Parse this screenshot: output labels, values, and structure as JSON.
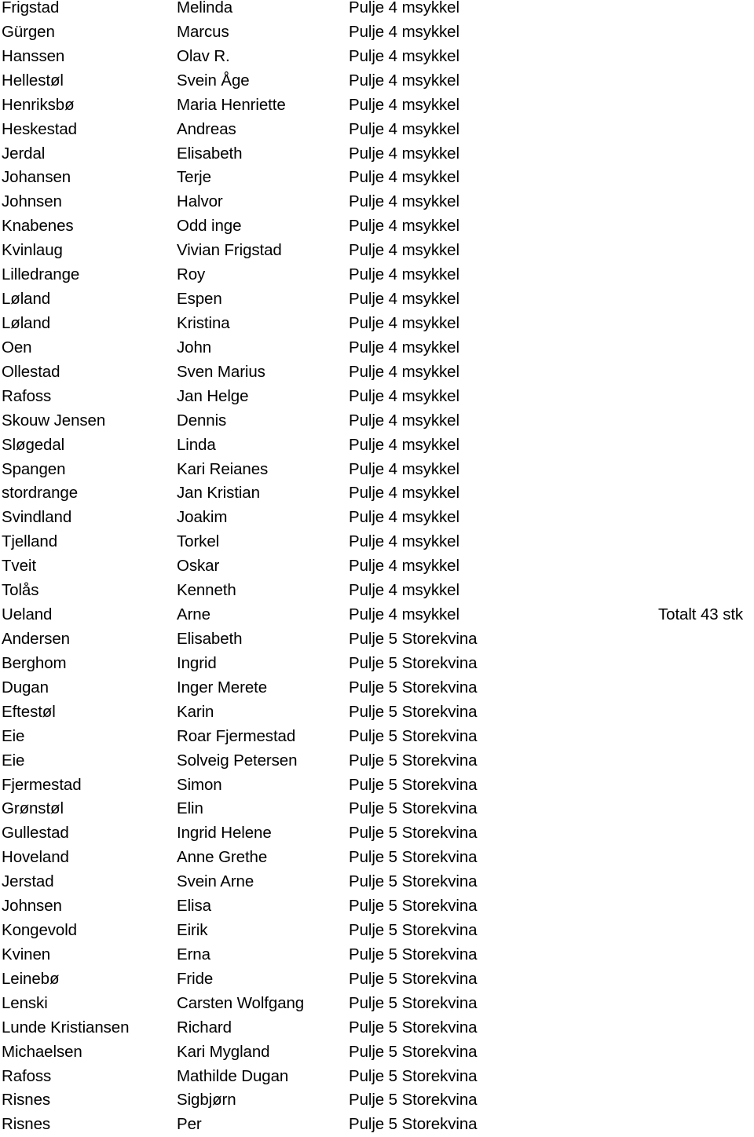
{
  "document": {
    "rows": [
      {
        "last_name": "Frigstad",
        "first_name": "Melinda",
        "pool": "Pulje 4 msykkel",
        "note": ""
      },
      {
        "last_name": "Gürgen",
        "first_name": "Marcus",
        "pool": "Pulje 4 msykkel",
        "note": ""
      },
      {
        "last_name": "Hanssen",
        "first_name": "Olav R.",
        "pool": "Pulje 4 msykkel",
        "note": ""
      },
      {
        "last_name": "Hellestøl",
        "first_name": "Svein Åge",
        "pool": "Pulje 4 msykkel",
        "note": ""
      },
      {
        "last_name": "Henriksbø",
        "first_name": "Maria Henriette",
        "pool": "Pulje 4 msykkel",
        "note": ""
      },
      {
        "last_name": "Heskestad",
        "first_name": "Andreas",
        "pool": "Pulje 4 msykkel",
        "note": ""
      },
      {
        "last_name": "Jerdal",
        "first_name": "Elisabeth",
        "pool": "Pulje 4 msykkel",
        "note": ""
      },
      {
        "last_name": "Johansen",
        "first_name": "Terje",
        "pool": "Pulje 4 msykkel",
        "note": ""
      },
      {
        "last_name": "Johnsen",
        "first_name": "Halvor",
        "pool": "Pulje 4 msykkel",
        "note": ""
      },
      {
        "last_name": "Knabenes",
        "first_name": "Odd inge",
        "pool": "Pulje 4 msykkel",
        "note": ""
      },
      {
        "last_name": "Kvinlaug",
        "first_name": "Vivian Frigstad",
        "pool": "Pulje 4 msykkel",
        "note": ""
      },
      {
        "last_name": "Lilledrange",
        "first_name": "Roy",
        "pool": "Pulje 4 msykkel",
        "note": ""
      },
      {
        "last_name": "Løland",
        "first_name": "Espen",
        "pool": "Pulje 4 msykkel",
        "note": ""
      },
      {
        "last_name": "Løland",
        "first_name": "Kristina",
        "pool": "Pulje 4 msykkel",
        "note": ""
      },
      {
        "last_name": "Oen",
        "first_name": "John",
        "pool": "Pulje 4 msykkel",
        "note": ""
      },
      {
        "last_name": "Ollestad",
        "first_name": "Sven Marius",
        "pool": "Pulje 4 msykkel",
        "note": ""
      },
      {
        "last_name": "Rafoss",
        "first_name": "Jan Helge",
        "pool": "Pulje 4 msykkel",
        "note": ""
      },
      {
        "last_name": "Skouw Jensen",
        "first_name": "Dennis",
        "pool": "Pulje 4 msykkel",
        "note": ""
      },
      {
        "last_name": "Sløgedal",
        "first_name": "Linda",
        "pool": "Pulje 4 msykkel",
        "note": ""
      },
      {
        "last_name": "Spangen",
        "first_name": "Kari Reianes",
        "pool": "Pulje 4 msykkel",
        "note": ""
      },
      {
        "last_name": "stordrange",
        "first_name": "Jan Kristian",
        "pool": "Pulje 4 msykkel",
        "note": ""
      },
      {
        "last_name": "Svindland",
        "first_name": "Joakim",
        "pool": "Pulje 4 msykkel",
        "note": ""
      },
      {
        "last_name": "Tjelland",
        "first_name": "Torkel",
        "pool": "Pulje 4 msykkel",
        "note": ""
      },
      {
        "last_name": "Tveit",
        "first_name": "Oskar",
        "pool": "Pulje 4 msykkel",
        "note": ""
      },
      {
        "last_name": "Tolås",
        "first_name": "Kenneth",
        "pool": "Pulje 4 msykkel",
        "note": ""
      },
      {
        "last_name": "Ueland",
        "first_name": "Arne",
        "pool": "Pulje 4 msykkel",
        "note": "Totalt 43 stk"
      },
      {
        "last_name": "Andersen",
        "first_name": "Elisabeth",
        "pool": "Pulje 5 Storekvina",
        "note": ""
      },
      {
        "last_name": "Berghom",
        "first_name": "Ingrid",
        "pool": "Pulje 5 Storekvina",
        "note": ""
      },
      {
        "last_name": "Dugan",
        "first_name": "Inger Merete",
        "pool": "Pulje 5 Storekvina",
        "note": ""
      },
      {
        "last_name": "Eftestøl",
        "first_name": "Karin",
        "pool": "Pulje 5 Storekvina",
        "note": ""
      },
      {
        "last_name": "Eie",
        "first_name": "Roar Fjermestad",
        "pool": "Pulje 5 Storekvina",
        "note": ""
      },
      {
        "last_name": "Eie",
        "first_name": "Solveig Petersen",
        "pool": "Pulje 5 Storekvina",
        "note": ""
      },
      {
        "last_name": "Fjermestad",
        "first_name": "Simon",
        "pool": "Pulje 5 Storekvina",
        "note": ""
      },
      {
        "last_name": "Grønstøl",
        "first_name": "Elin",
        "pool": "Pulje 5 Storekvina",
        "note": ""
      },
      {
        "last_name": "Gullestad",
        "first_name": "Ingrid Helene",
        "pool": "Pulje 5 Storekvina",
        "note": ""
      },
      {
        "last_name": "Hoveland",
        "first_name": "Anne Grethe",
        "pool": "Pulje 5 Storekvina",
        "note": ""
      },
      {
        "last_name": "Jerstad",
        "first_name": "Svein Arne",
        "pool": "Pulje 5 Storekvina",
        "note": ""
      },
      {
        "last_name": "Johnsen",
        "first_name": "Elisa",
        "pool": "Pulje 5 Storekvina",
        "note": ""
      },
      {
        "last_name": "Kongevold",
        "first_name": "Eirik",
        "pool": "Pulje 5 Storekvina",
        "note": ""
      },
      {
        "last_name": "Kvinen",
        "first_name": "Erna",
        "pool": "Pulje 5 Storekvina",
        "note": ""
      },
      {
        "last_name": "Leinebø",
        "first_name": "Fride",
        "pool": "Pulje 5 Storekvina",
        "note": ""
      },
      {
        "last_name": "Lenski",
        "first_name": "Carsten Wolfgang",
        "pool": "Pulje 5 Storekvina",
        "note": ""
      },
      {
        "last_name": "Lunde Kristiansen",
        "first_name": "Richard",
        "pool": "Pulje 5 Storekvina",
        "note": ""
      },
      {
        "last_name": "Michaelsen",
        "first_name": "Kari Mygland",
        "pool": "Pulje 5 Storekvina",
        "note": ""
      },
      {
        "last_name": "Rafoss",
        "first_name": "Mathilde Dugan",
        "pool": "Pulje 5 Storekvina",
        "note": ""
      },
      {
        "last_name": "Risnes",
        "first_name": "Sigbjørn",
        "pool": "Pulje 5 Storekvina",
        "note": ""
      },
      {
        "last_name": "Risnes",
        "first_name": "Per",
        "pool": "Pulje 5 Storekvina",
        "note": ""
      }
    ]
  }
}
